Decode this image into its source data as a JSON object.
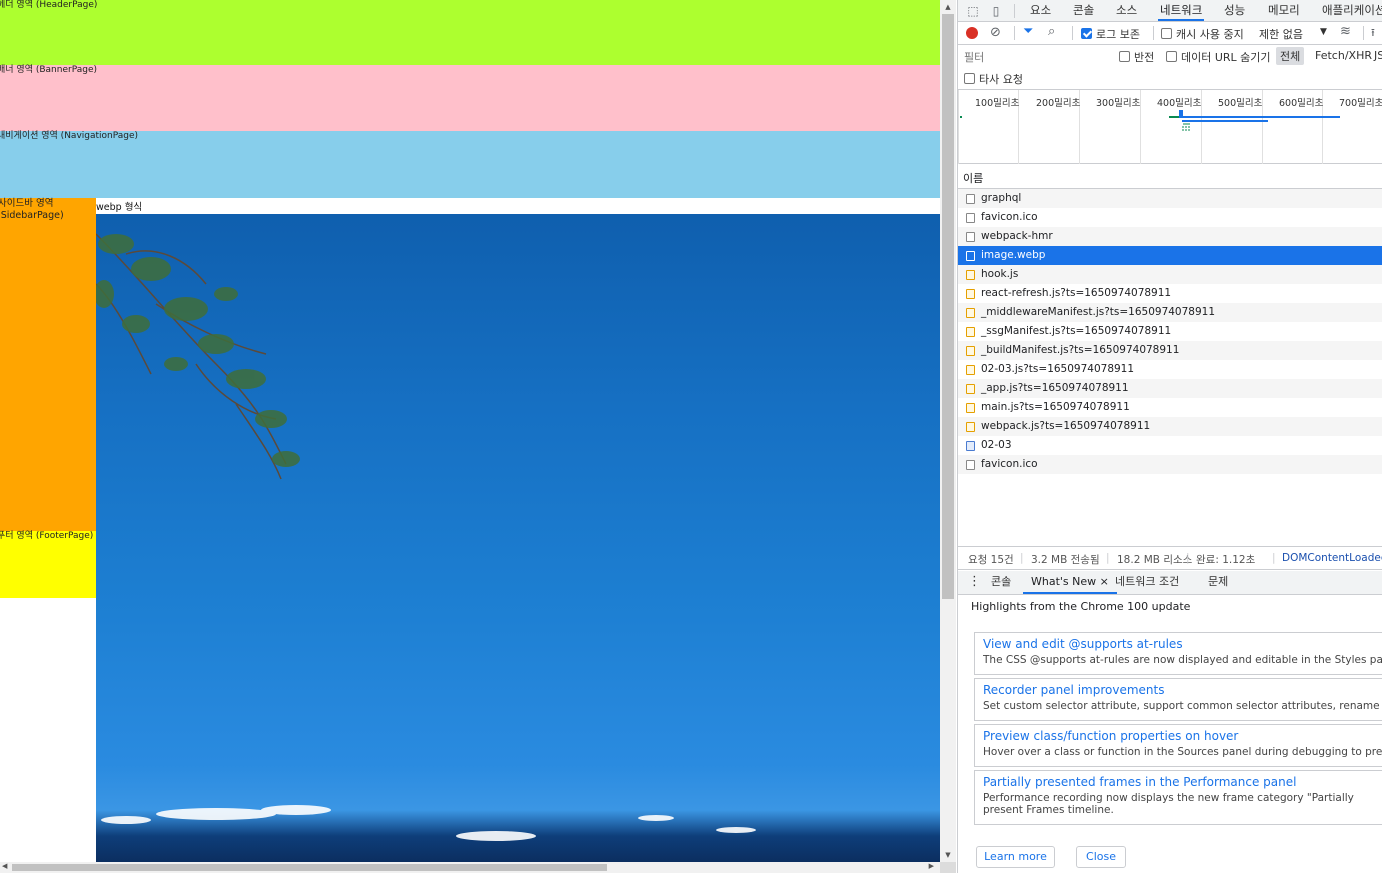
{
  "page": {
    "header_label": "헤더 영역 (HeaderPage)",
    "banner_label": "배너 영역 (BannerPage)",
    "nav_label": "내비게이션 영역 (NavigationPage)",
    "sidebar_label_1": "사이드바 영역",
    "sidebar_label_2": "(SidebarPage)",
    "footer_label": "푸터 영역 (FooterPage)",
    "content_caption": "webp 형식",
    "colors": {
      "header": "#adff2f",
      "banner": "#ffc0cb",
      "nav": "#87ceeb",
      "sidebar": "#ffa500",
      "footer": "#ffff00"
    }
  },
  "devtools": {
    "tabs": [
      "요소",
      "콘솔",
      "소스",
      "네트워크",
      "성능",
      "메모리",
      "애플리케이션"
    ],
    "active_tab": "네트워크",
    "toolbar": {
      "preserve_log": "로그 보존",
      "disable_cache": "캐시 사용 중지",
      "throttling": "제한 없음"
    },
    "filter": {
      "placeholder": "필터",
      "invert": "반전",
      "hide_data_urls": "데이터 URL 숨기기",
      "all": "전체",
      "fetch_xhr": "Fetch/XHR",
      "js": "JS",
      "third_party": "타사 요청"
    },
    "timeline_ticks": [
      "100밀리초",
      "200밀리초",
      "300밀리초",
      "400밀리초",
      "500밀리초",
      "600밀리초",
      "700밀리초"
    ],
    "column_name": "이름",
    "requests": [
      {
        "name": "graphql",
        "type": "other"
      },
      {
        "name": "favicon.ico",
        "type": "other"
      },
      {
        "name": "webpack-hmr",
        "type": "other"
      },
      {
        "name": "image.webp",
        "type": "img",
        "selected": true
      },
      {
        "name": "hook.js",
        "type": "js"
      },
      {
        "name": "react-refresh.js?ts=1650974078911",
        "type": "js"
      },
      {
        "name": "_middlewareManifest.js?ts=1650974078911",
        "type": "js"
      },
      {
        "name": "_ssgManifest.js?ts=1650974078911",
        "type": "js"
      },
      {
        "name": "_buildManifest.js?ts=1650974078911",
        "type": "js"
      },
      {
        "name": "02-03.js?ts=1650974078911",
        "type": "js"
      },
      {
        "name": "_app.js?ts=1650974078911",
        "type": "js"
      },
      {
        "name": "main.js?ts=1650974078911",
        "type": "js"
      },
      {
        "name": "webpack.js?ts=1650974078911",
        "type": "js"
      },
      {
        "name": "02-03",
        "type": "doc"
      },
      {
        "name": "favicon.ico",
        "type": "other"
      }
    ],
    "status": {
      "requests": "요청 15건",
      "transferred": "3.2 MB 전송됨",
      "resources": "18.2 MB 리소스",
      "finish": "완료: 1.12초",
      "dcl": "DOMContentLoaded:"
    },
    "drawer_tabs": [
      "콘솔",
      "What's New",
      "네트워크 조건",
      "문제"
    ],
    "drawer_close": "×",
    "highlights_title": "Highlights from the Chrome 100 update",
    "cards": [
      {
        "title": "View and edit @supports at-rules",
        "desc": "The CSS @supports at-rules are now displayed and editable in the Styles pane"
      },
      {
        "title": "Recorder panel improvements",
        "desc": "Set custom selector attribute, support common selector attributes, rename rec"
      },
      {
        "title": "Preview class/function properties on hover",
        "desc": "Hover over a class or function in the Sources panel during debugging to previ"
      },
      {
        "title": "Partially presented frames in the Performance panel",
        "desc": "Performance recording now displays the new frame category \"Partially present Frames timeline."
      }
    ],
    "learn_more": "Learn more",
    "close": "Close"
  }
}
